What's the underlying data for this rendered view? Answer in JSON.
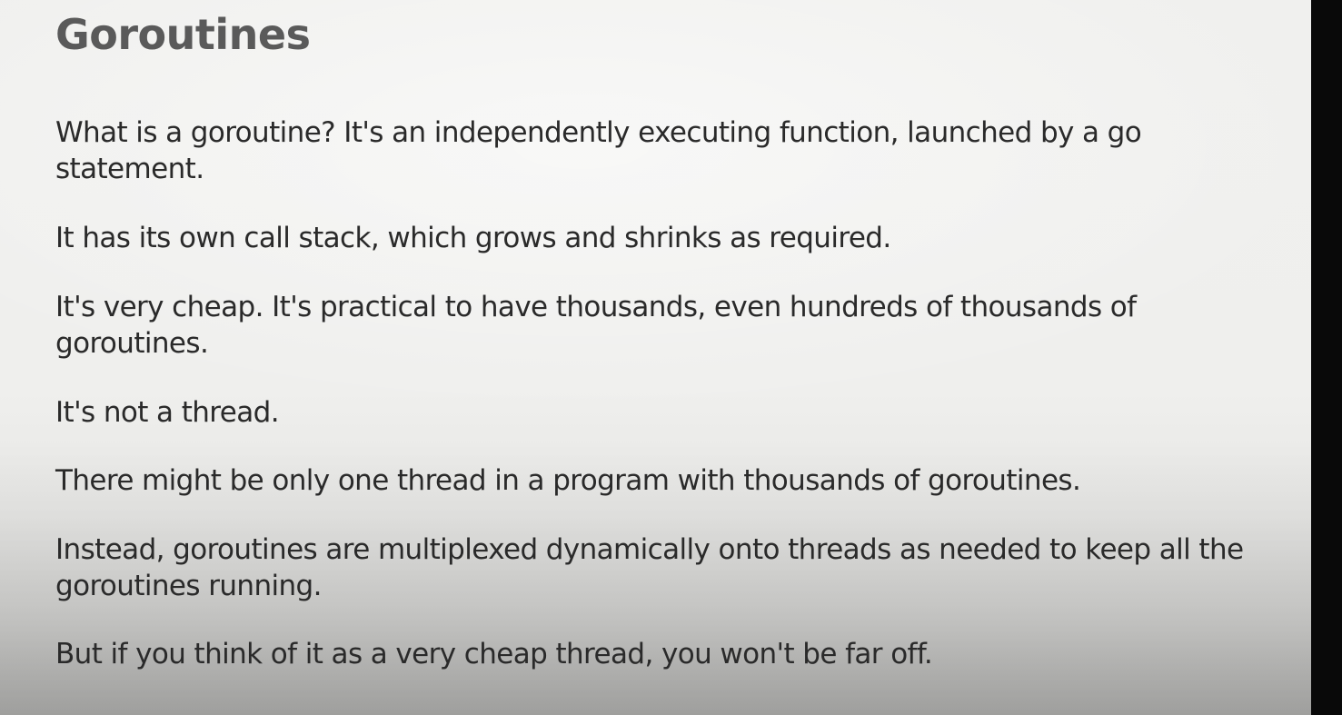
{
  "slide": {
    "title": "Goroutines",
    "paragraphs": [
      "What is a goroutine? It's an independently executing function, launched by a go statement.",
      "It has its own call stack, which grows and shrinks as required.",
      "It's very cheap. It's practical to have thousands, even hundreds of thousands of goroutines.",
      "It's not a thread.",
      "There might be only one thread in a program with thousands of goroutines.",
      "Instead, goroutines are multiplexed dynamically onto threads as needed to keep all the goroutines running.",
      "But if you think of it as a very cheap thread, you won't be far off."
    ]
  },
  "colors": {
    "title": "#5a5a5a",
    "body_text": "#2a2a2a",
    "background": "#f0f0ee",
    "frame_edge": "#090909"
  }
}
